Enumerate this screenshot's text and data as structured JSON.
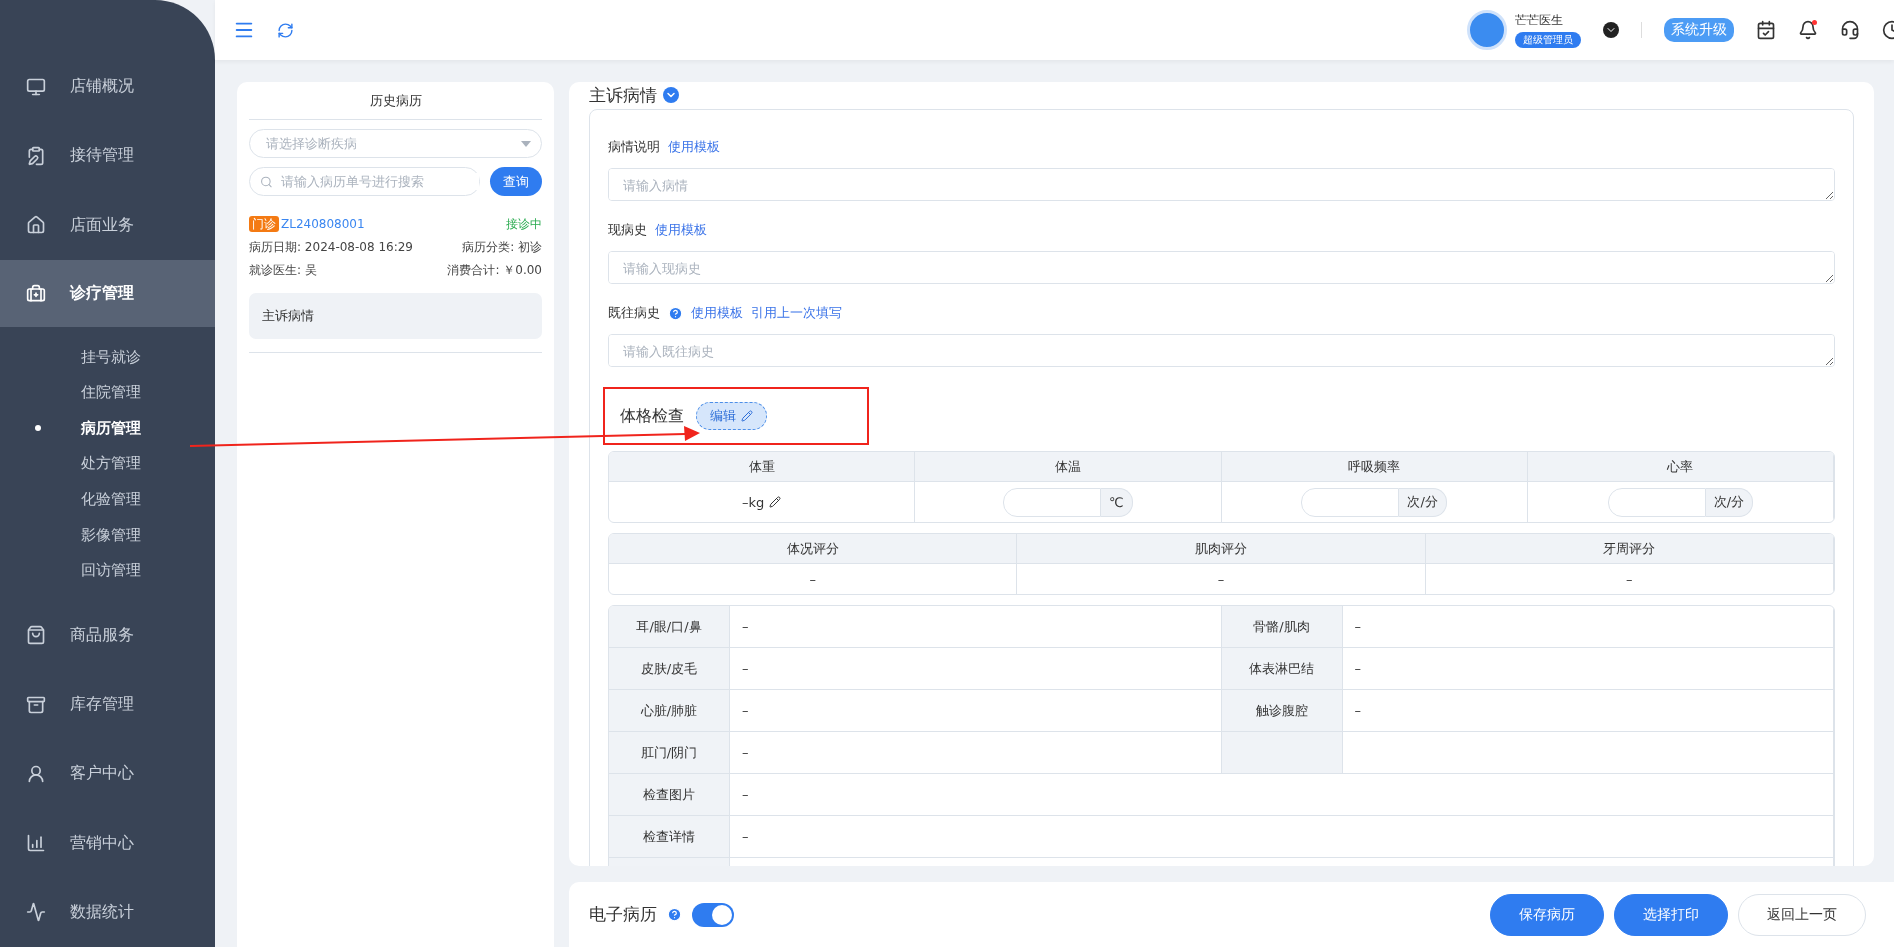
{
  "sidebar": {
    "items": [
      {
        "label": "店铺概况",
        "kind": "monitor",
        "expanded": false
      },
      {
        "label": "接待管理",
        "kind": "clipboard",
        "expanded": false
      },
      {
        "label": "店面业务",
        "kind": "house",
        "expanded": false
      },
      {
        "label": "诊疗管理",
        "kind": "medkit",
        "expanded": true,
        "children": [
          {
            "label": "挂号就诊",
            "selected": false
          },
          {
            "label": "住院管理",
            "selected": false
          },
          {
            "label": "病历管理",
            "selected": true
          },
          {
            "label": "处方管理",
            "selected": false
          },
          {
            "label": "化验管理",
            "selected": false
          },
          {
            "label": "影像管理",
            "selected": false
          },
          {
            "label": "回访管理",
            "selected": false
          }
        ]
      },
      {
        "label": "商品服务",
        "kind": "bag",
        "expanded": false
      },
      {
        "label": "库存管理",
        "kind": "archive",
        "expanded": false
      },
      {
        "label": "客户中心",
        "kind": "user",
        "expanded": false
      },
      {
        "label": "营销中心",
        "kind": "chart",
        "expanded": false
      },
      {
        "label": "数据统计",
        "kind": "trend",
        "expanded": false
      }
    ]
  },
  "topbar": {
    "user_name": "芒芒医生",
    "role": "超级管理员",
    "upgrade_button": "系统升级"
  },
  "history": {
    "title": "历史病历",
    "disease_select": {
      "placeholder": "请选择诊断疾病"
    },
    "search": {
      "placeholder": "请输入病历单号进行搜索"
    },
    "search_button": "查询",
    "records": [
      {
        "type": "门诊",
        "number": "ZL240808001",
        "status": "接诊中",
        "date": "病历日期: 2024-08-08 16:29",
        "category": "病历分类: 初诊",
        "doctor": "就诊医生: 吴",
        "total": "消费合计: ￥0.00",
        "sections": [
          "主诉病情"
        ]
      }
    ]
  },
  "main": {
    "section_title": "主诉病情",
    "fields": [
      {
        "label": "病情说明",
        "help": false,
        "links": [
          "使用模板"
        ],
        "placeholder": "请输入病情"
      },
      {
        "label": "现病史",
        "help": false,
        "links": [
          "使用模板"
        ],
        "placeholder": "请输入现病史"
      },
      {
        "label": "既往病史",
        "help": true,
        "links": [
          "使用模板",
          "引用上一次填写"
        ],
        "placeholder": "请输入既往病史"
      }
    ],
    "exam": {
      "title": "体格检查",
      "edit_button": "编辑",
      "vitals": [
        {
          "label": "体重",
          "kind": "text",
          "value": "–kg"
        },
        {
          "label": "体温",
          "kind": "input",
          "unit": "℃"
        },
        {
          "label": "呼吸频率",
          "kind": "input",
          "unit": "次/分"
        },
        {
          "label": "心率",
          "kind": "input",
          "unit": "次/分"
        }
      ],
      "scores": [
        {
          "label": "体况评分",
          "value": "–"
        },
        {
          "label": "肌肉评分",
          "value": "–"
        },
        {
          "label": "牙周评分",
          "value": "–"
        }
      ],
      "rows": [
        {
          "kind": "pair",
          "cells": [
            {
              "label": "耳/眼/口/鼻",
              "value": "–"
            },
            {
              "label": "骨骼/肌肉",
              "value": "–"
            }
          ]
        },
        {
          "kind": "pair",
          "cells": [
            {
              "label": "皮肤/皮毛",
              "value": "–"
            },
            {
              "label": "体表淋巴结",
              "value": "–"
            }
          ]
        },
        {
          "kind": "pair",
          "cells": [
            {
              "label": "心脏/肺脏",
              "value": "–"
            },
            {
              "label": "触诊腹腔",
              "value": "–"
            }
          ]
        },
        {
          "kind": "half",
          "cells": [
            {
              "label": "肛门/阴门",
              "value": "–"
            }
          ]
        },
        {
          "kind": "full",
          "cells": [
            {
              "label": "检查图片",
              "value": "–"
            }
          ]
        },
        {
          "kind": "full",
          "cells": [
            {
              "label": "检查详情",
              "value": "–"
            }
          ]
        },
        {
          "kind": "empty"
        }
      ]
    }
  },
  "footer": {
    "record_label": "电子病历",
    "record_toggle": {
      "on": true
    },
    "buttons": [
      {
        "label": "保存病历",
        "kind": "primary"
      },
      {
        "label": "选择打印",
        "kind": "primary"
      },
      {
        "label": "返回上一页",
        "kind": "plain"
      }
    ]
  }
}
